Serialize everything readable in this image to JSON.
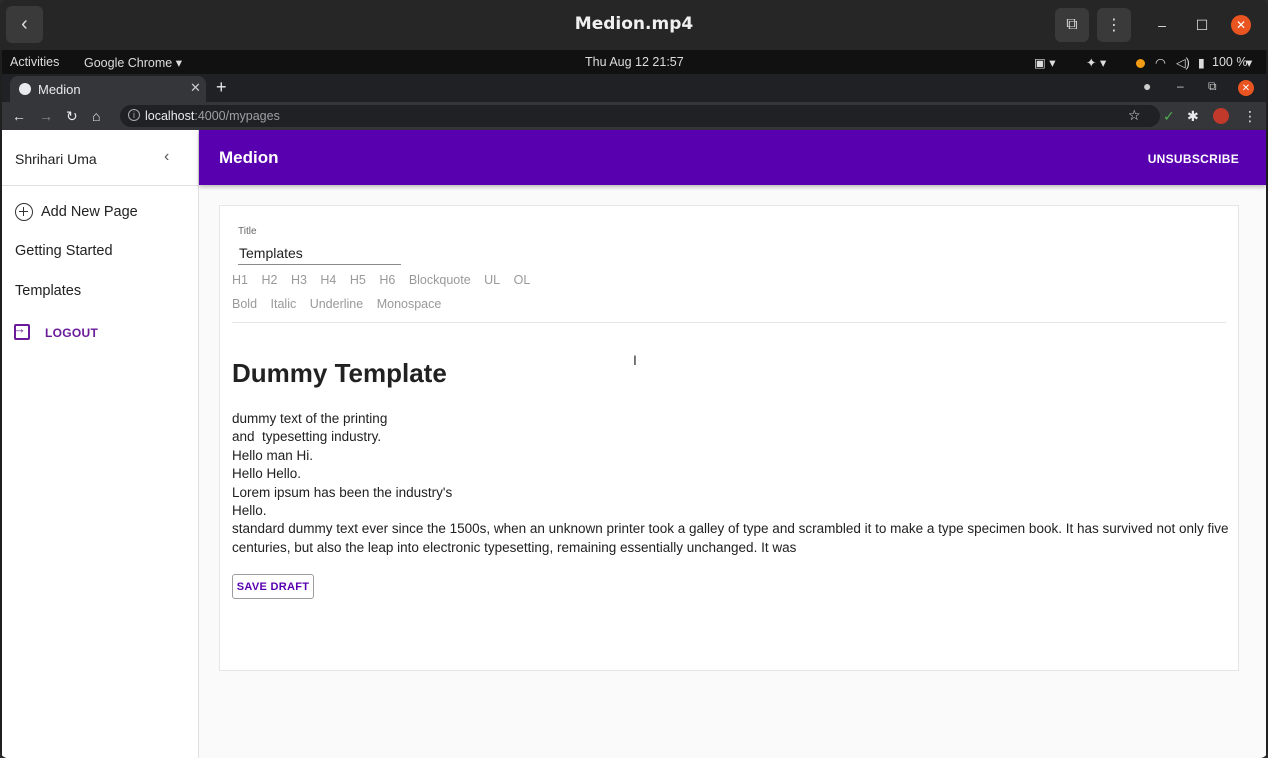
{
  "player": {
    "title": "Medion.mp4",
    "back_glyph": "‹"
  },
  "system_bar": {
    "activities": "Activities",
    "app_menu": "Google Chrome ▾",
    "clock": "Thu Aug 12  21:57",
    "battery": "100 %"
  },
  "browser": {
    "tab_title": "Medion",
    "url_host": "localhost",
    "url_path": ":4000/mypages"
  },
  "app": {
    "brand": "Medion",
    "unsubscribe_label": "UNSUBSCRIBE",
    "user_name": "Shrihari Uma",
    "nav": {
      "add_new_page": "Add New Page",
      "getting_started": "Getting Started",
      "templates": "Templates",
      "logout": "LOGOUT"
    },
    "editor": {
      "title_label": "Title",
      "title_value": "Templates",
      "format_buttons_row1": [
        "H1",
        "H2",
        "H3",
        "H4",
        "H5",
        "H6",
        "Blockquote",
        "UL",
        "OL"
      ],
      "format_buttons_row2": [
        "Bold",
        "Italic",
        "Underline",
        "Monospace"
      ],
      "heading": "Dummy Template",
      "body_lines": [
        "dummy text of the printing",
        "and  typesetting industry.",
        "Hello man Hi.",
        "Hello Hello.",
        "Lorem ipsum has been the industry's",
        "Hello.",
        "standard dummy text ever since the 1500s, when an unknown printer took a galley of type and scrambled it to make a type specimen book. It has survived not only five centuries, but also the leap into electronic typesetting, remaining essentially unchanged. It was"
      ],
      "save_draft_label": "SAVE DRAFT"
    }
  },
  "colors": {
    "appbar": "#5800b0",
    "logout": "#6a1b9a",
    "close_orange": "#e95420"
  }
}
